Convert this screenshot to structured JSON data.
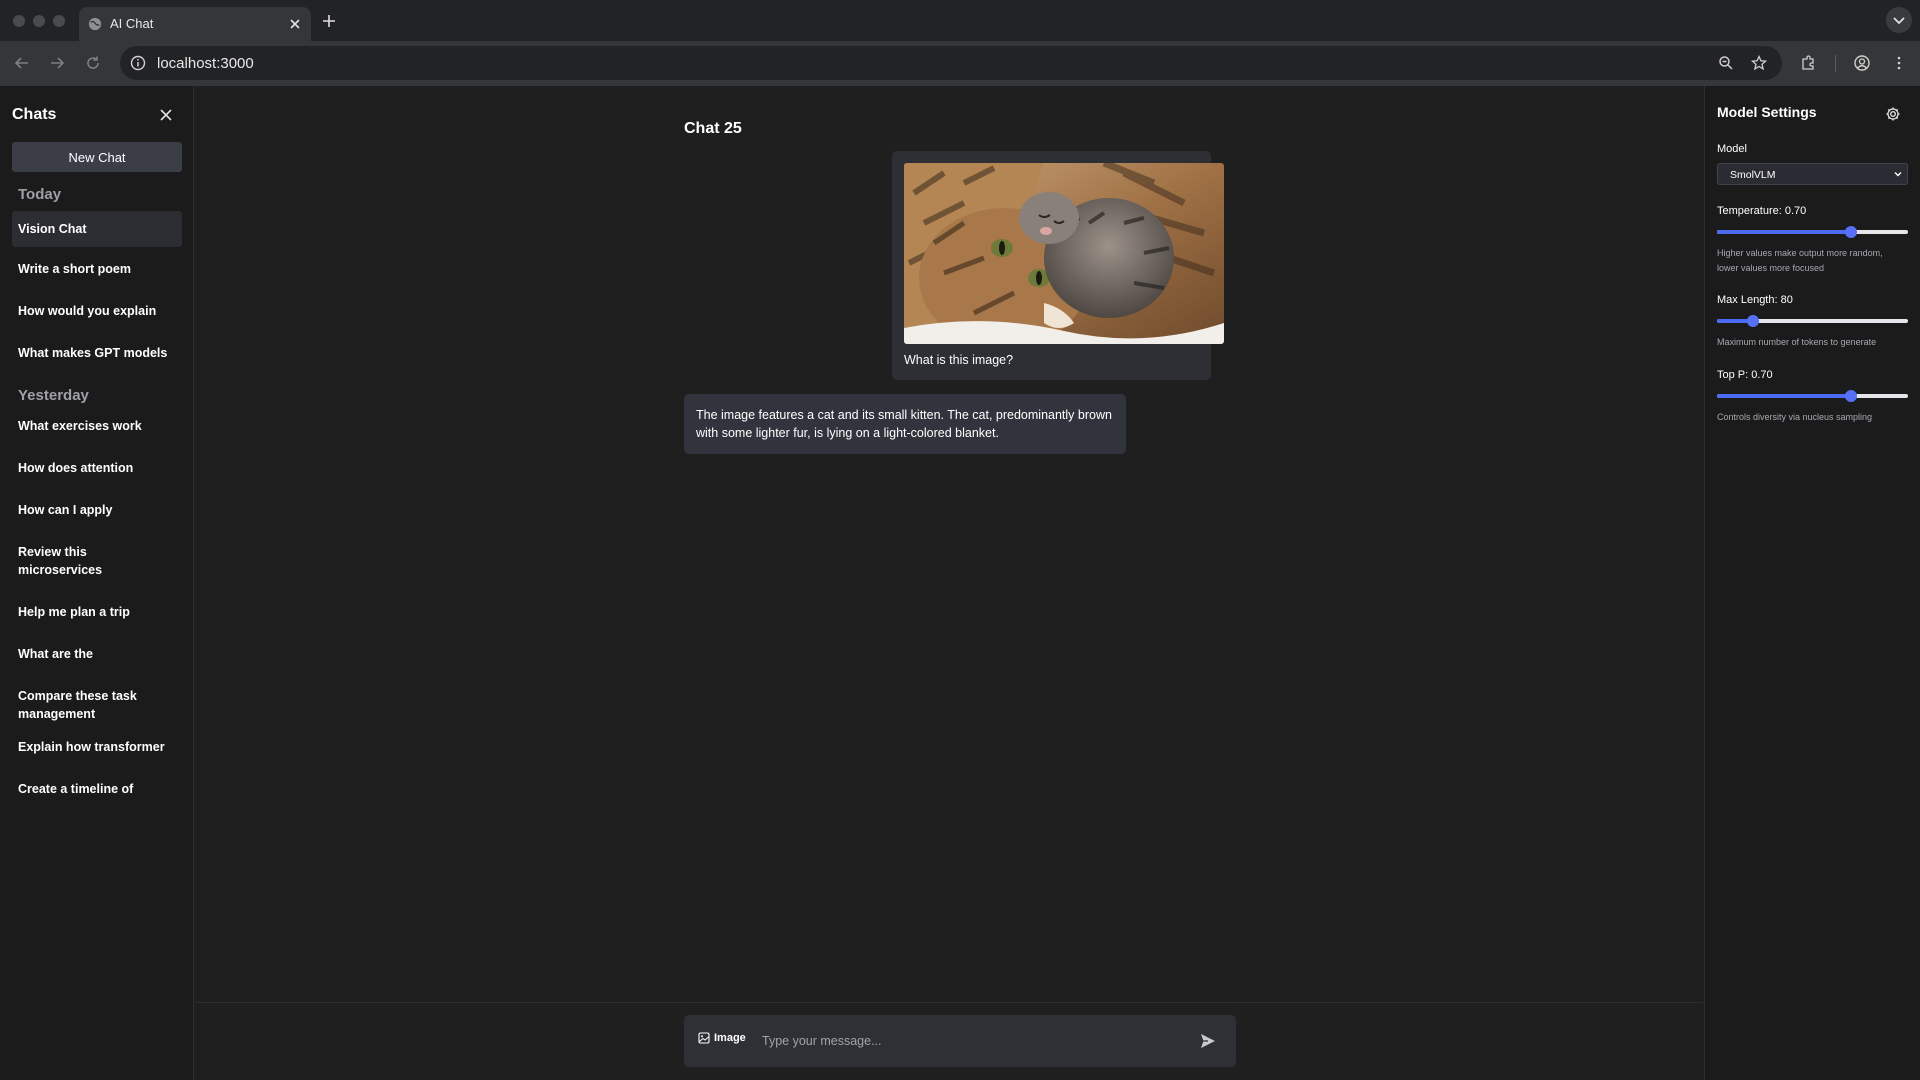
{
  "browser": {
    "tab_title": "AI Chat",
    "url": "localhost:3000"
  },
  "sidebar": {
    "title": "Chats",
    "new_chat_label": "New Chat",
    "sections": [
      {
        "label": "Today",
        "items": [
          "Vision Chat",
          "Write a short poem",
          "How would you explain",
          "What makes GPT models"
        ]
      },
      {
        "label": "Yesterday",
        "items": [
          "What exercises work",
          "How does attention",
          "How can I apply",
          "Review this microservices",
          "Help me plan a trip",
          "What are the",
          "Compare these task management",
          "Explain how transformer",
          "Create a timeline of"
        ]
      }
    ],
    "active_item": "Vision Chat"
  },
  "chat": {
    "title": "Chat 25",
    "user_message": {
      "image_alt": "cat and kitten photo",
      "text": "What is this image?"
    },
    "assistant_message": "The image features a cat and its small kitten. The cat, predominantly brown with some lighter fur, is lying on a light-colored blanket.",
    "composer": {
      "image_button_label": "Image",
      "placeholder": "Type your message..."
    }
  },
  "settings": {
    "title": "Model Settings",
    "model_label": "Model",
    "model_value": "SmolVLM",
    "temperature": {
      "label": "Temperature: 0.70",
      "value": 0.7,
      "min": 0,
      "max": 1,
      "help": "Higher values make output more random, lower values more focused"
    },
    "max_length": {
      "label": "Max Length: 80",
      "value": 80,
      "fraction": 0.19,
      "help": "Maximum number of tokens to generate"
    },
    "top_p": {
      "label": "Top P: 0.70",
      "value": 0.7,
      "min": 0,
      "max": 1,
      "help": "Controls diversity via nucleus sampling"
    }
  },
  "colors": {
    "accent": "#4d6bf0",
    "background": "#1f1f1f",
    "sidebar": "#1b1b1c",
    "bubble_user": "#2e2f35",
    "bubble_assistant": "#31343c"
  }
}
